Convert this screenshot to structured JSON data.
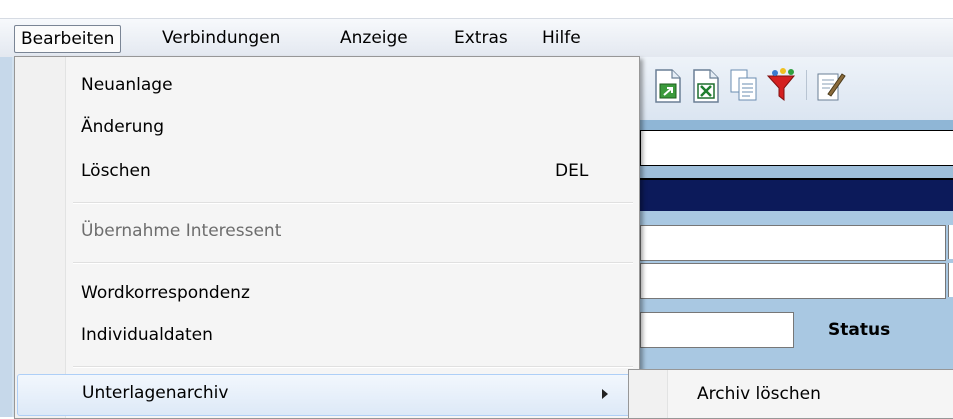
{
  "menubar": {
    "items": [
      {
        "label": "Bearbeiten"
      },
      {
        "label": "Verbindungen"
      },
      {
        "label": "Anzeige"
      },
      {
        "label": "Extras"
      },
      {
        "label": "Hilfe"
      }
    ]
  },
  "dropdown": {
    "items": [
      {
        "label": "Neuanlage",
        "shortcut": ""
      },
      {
        "label": "Änderung",
        "shortcut": ""
      },
      {
        "label": "Löschen",
        "shortcut": "DEL"
      },
      {
        "label": "Übernahme Interessent",
        "disabled": true
      },
      {
        "label": "Wordkorrespondenz"
      },
      {
        "label": "Individualdaten"
      },
      {
        "label": "Unterlagenarchiv",
        "has_submenu": true
      }
    ]
  },
  "submenu": {
    "items": [
      {
        "label": "Archiv löschen"
      }
    ]
  },
  "form": {
    "status_label": "Status"
  },
  "toolbar": {
    "icons": [
      "import-document-icon",
      "excel-export-icon",
      "copy-document-icon",
      "filter-funnel-icon",
      "edit-document-icon"
    ]
  }
}
